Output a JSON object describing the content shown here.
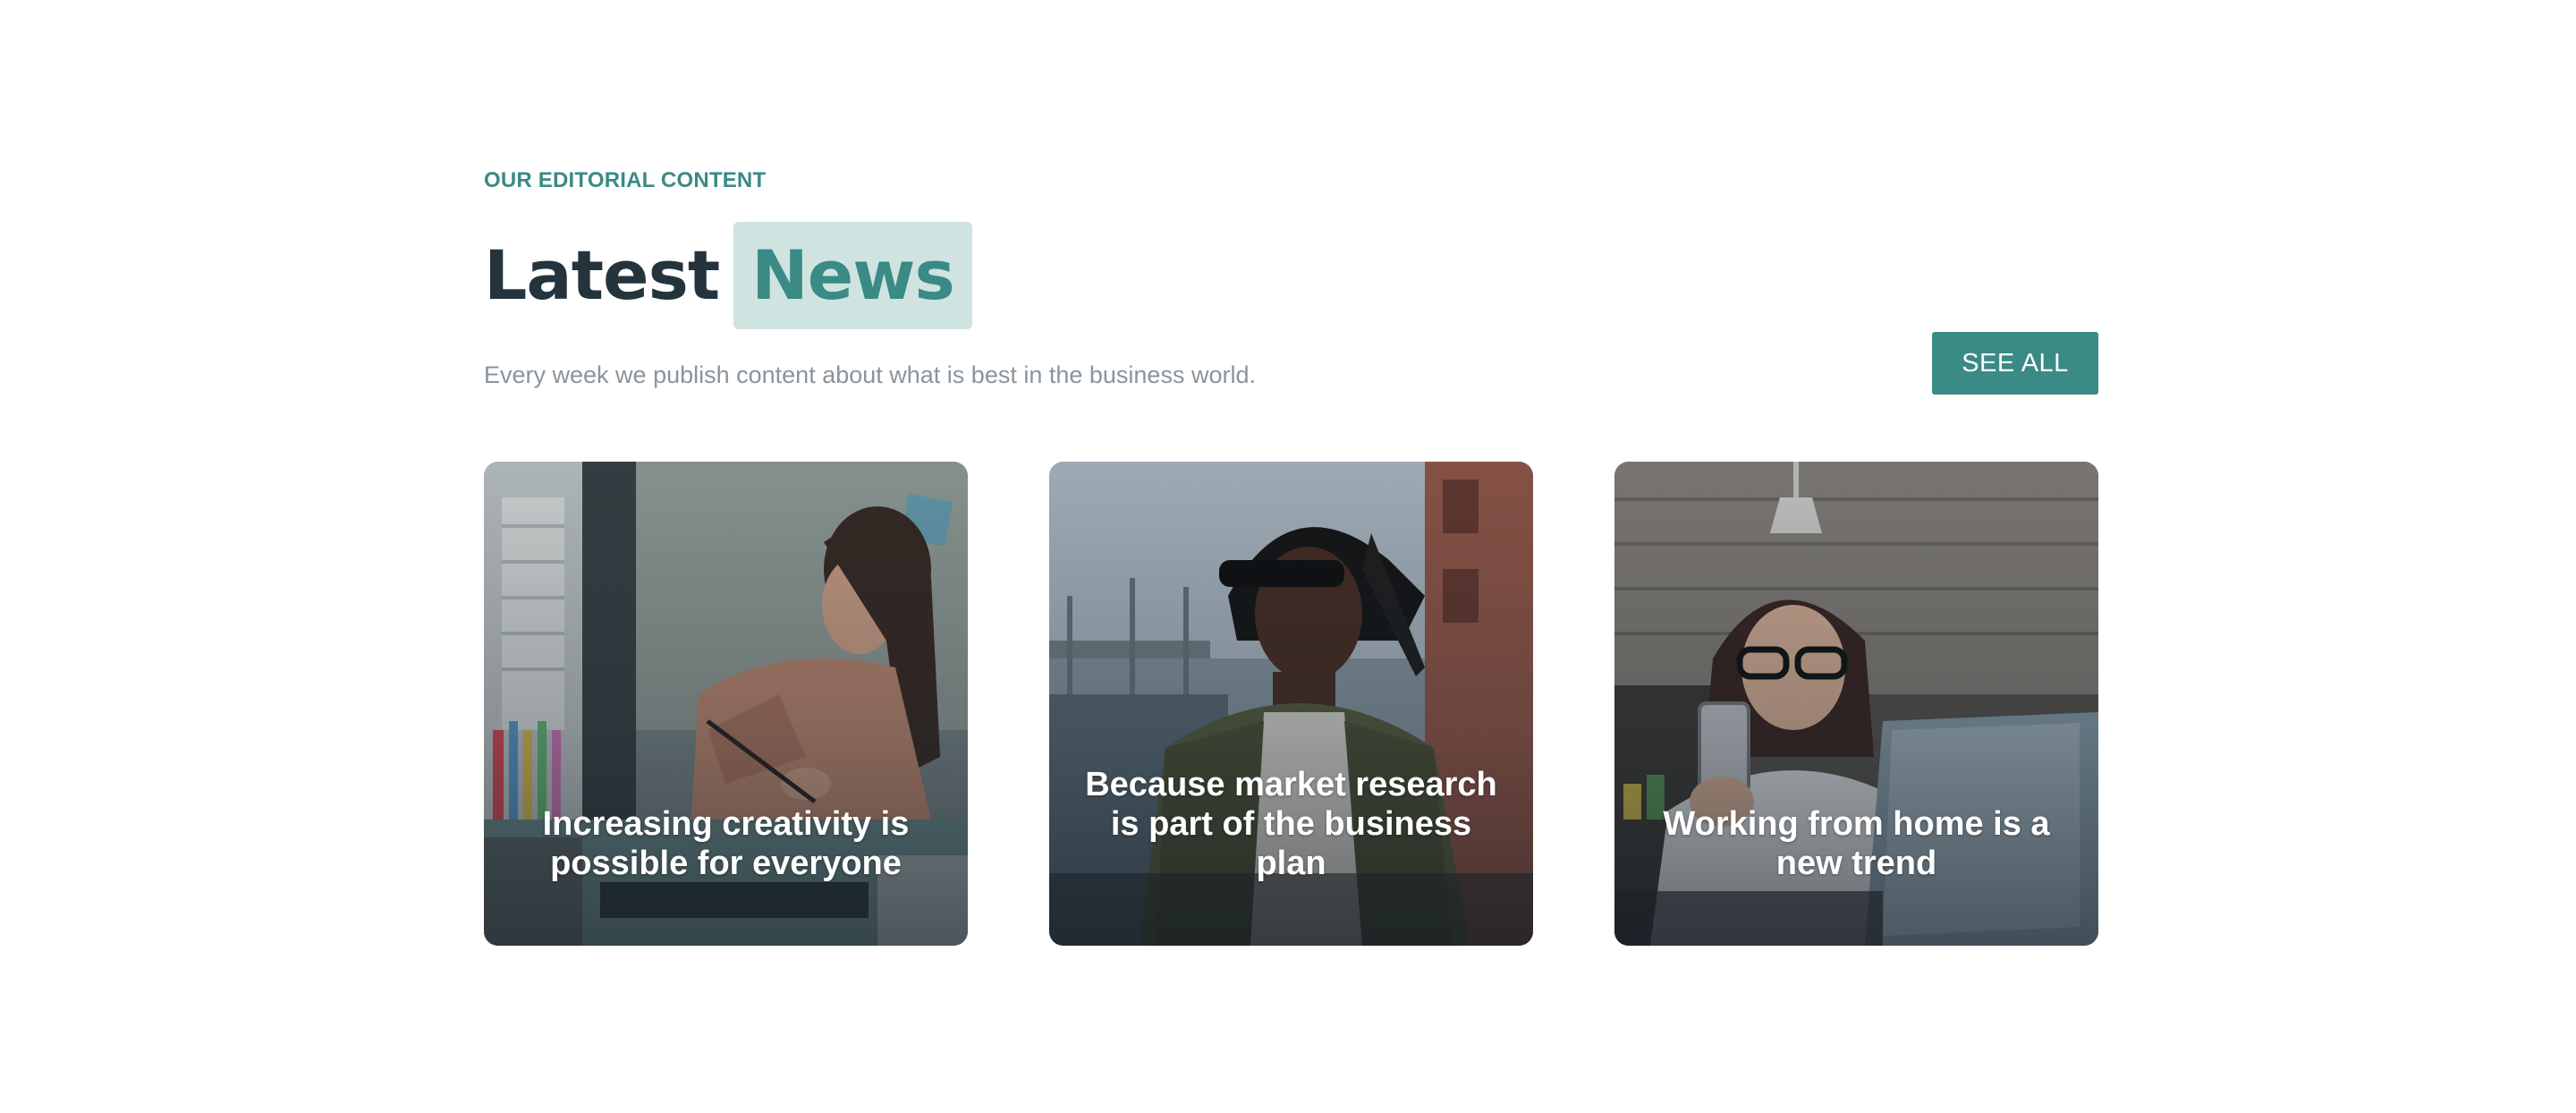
{
  "section": {
    "eyebrow": "OUR EDITORIAL CONTENT",
    "heading_word_1": "Latest",
    "heading_word_2": "News",
    "subtitle": "Every week we publish content about what is best in the business world.",
    "see_all_label": "SEE ALL"
  },
  "cards": [
    {
      "title": "Increasing creativity is possible for everyone",
      "image": "woman-drawing-at-desk-photo"
    },
    {
      "title": "Because market research is part of the business plan",
      "image": "man-with-sunglasses-photo"
    },
    {
      "title": "Working from home is a new trend",
      "image": "woman-with-phone-and-laptop-photo"
    }
  ],
  "colors": {
    "accent": "#3a8a85",
    "accent_light": "#cfe3e0",
    "heading": "#25333d",
    "muted_text": "#8a949d",
    "background": "#ffffff"
  }
}
